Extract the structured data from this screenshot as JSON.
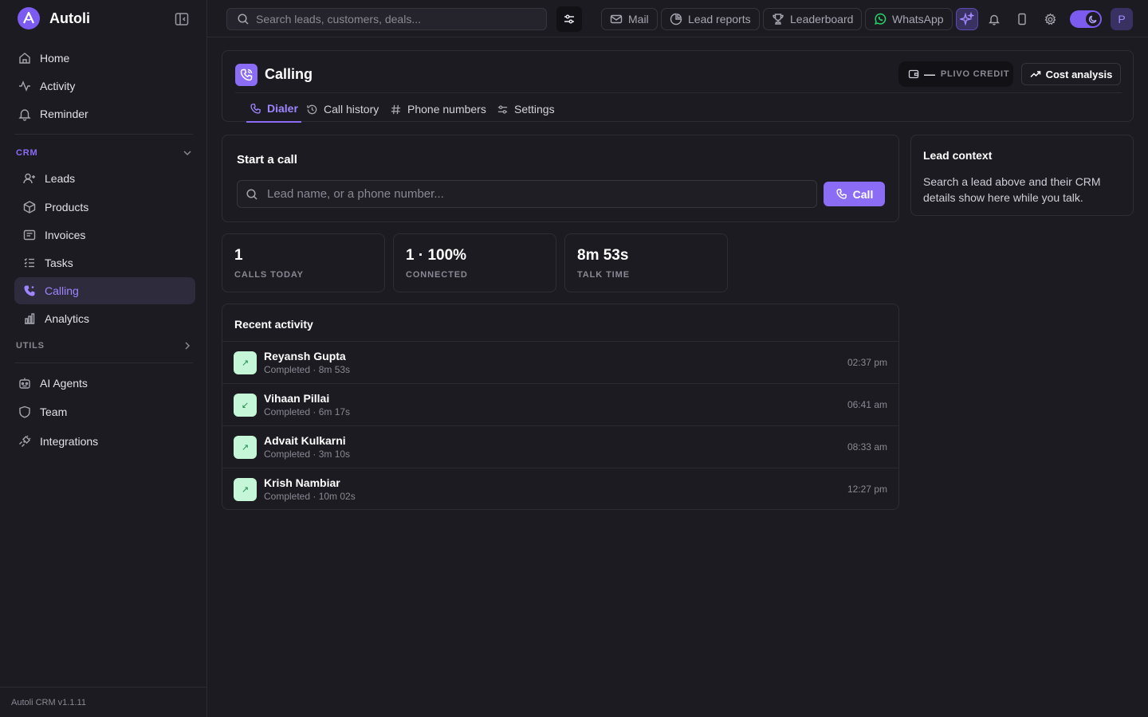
{
  "app": {
    "name": "Autoli",
    "version": "Autoli CRM v1.1.11"
  },
  "sidebar": {
    "top_items": [
      {
        "label": "Home",
        "icon": "home-icon"
      },
      {
        "label": "Activity",
        "icon": "activity-icon"
      },
      {
        "label": "Reminder",
        "icon": "bell-icon"
      }
    ],
    "crm_section": {
      "label": "CRM",
      "color": "#8b6cf5"
    },
    "crm_items": [
      {
        "label": "Leads",
        "icon": "users-icon"
      },
      {
        "label": "Products",
        "icon": "box-icon"
      },
      {
        "label": "Invoices",
        "icon": "invoice-icon"
      },
      {
        "label": "Tasks",
        "icon": "list-icon"
      },
      {
        "label": "Calling",
        "icon": "phone-icon",
        "active": true
      },
      {
        "label": "Analytics",
        "icon": "bar-chart-icon"
      }
    ],
    "utils_section": {
      "label": "UTILS"
    },
    "bottom_items": [
      {
        "label": "AI Agents",
        "icon": "robot-icon"
      },
      {
        "label": "Team",
        "icon": "shield-icon"
      },
      {
        "label": "Integrations",
        "icon": "plug-icon"
      }
    ]
  },
  "topbar": {
    "search_placeholder": "Search leads, customers, deals...",
    "pills": {
      "mail": "Mail",
      "lead_reports": "Lead reports",
      "leaderboard": "Leaderboard",
      "whatsapp": "WhatsApp"
    },
    "avatar_initial": "P"
  },
  "page": {
    "title": "Calling",
    "credit": {
      "value": "—",
      "label": "PLIVO CREDIT"
    },
    "cost_button": "Cost analysis",
    "tabs": [
      {
        "label": "Dialer",
        "active": true
      },
      {
        "label": "Call history"
      },
      {
        "label": "Phone numbers"
      },
      {
        "label": "Settings"
      }
    ]
  },
  "dialer": {
    "title": "Start a call",
    "input_placeholder": "Lead name, or a phone number...",
    "call_button": "Call"
  },
  "lead_context": {
    "title": "Lead context",
    "description": "Search a lead above and their CRM details show here while you talk."
  },
  "stats": [
    {
      "value": "1",
      "label": "CALLS TODAY"
    },
    {
      "value": "1 · 100%",
      "label": "CONNECTED"
    },
    {
      "value": "8m 53s",
      "label": "TALK TIME"
    }
  ],
  "recent": {
    "title": "Recent activity",
    "items": [
      {
        "name": "Reyansh Gupta",
        "status": "Completed · 8m 53s",
        "time": "02:37 pm",
        "icon": "↗"
      },
      {
        "name": "Vihaan Pillai",
        "status": "Completed · 6m 17s",
        "time": "06:41 am",
        "icon": "↙"
      },
      {
        "name": "Advait Kulkarni",
        "status": "Completed · 3m 10s",
        "time": "08:33 am",
        "icon": "↗"
      },
      {
        "name": "Krish Nambiar",
        "status": "Completed · 10m 02s",
        "time": "12:27 pm",
        "icon": "↗"
      }
    ]
  },
  "colors": {
    "accent": "#8b6cf5",
    "background": "#1c1b22",
    "success_bg": "#c5f6d7"
  }
}
